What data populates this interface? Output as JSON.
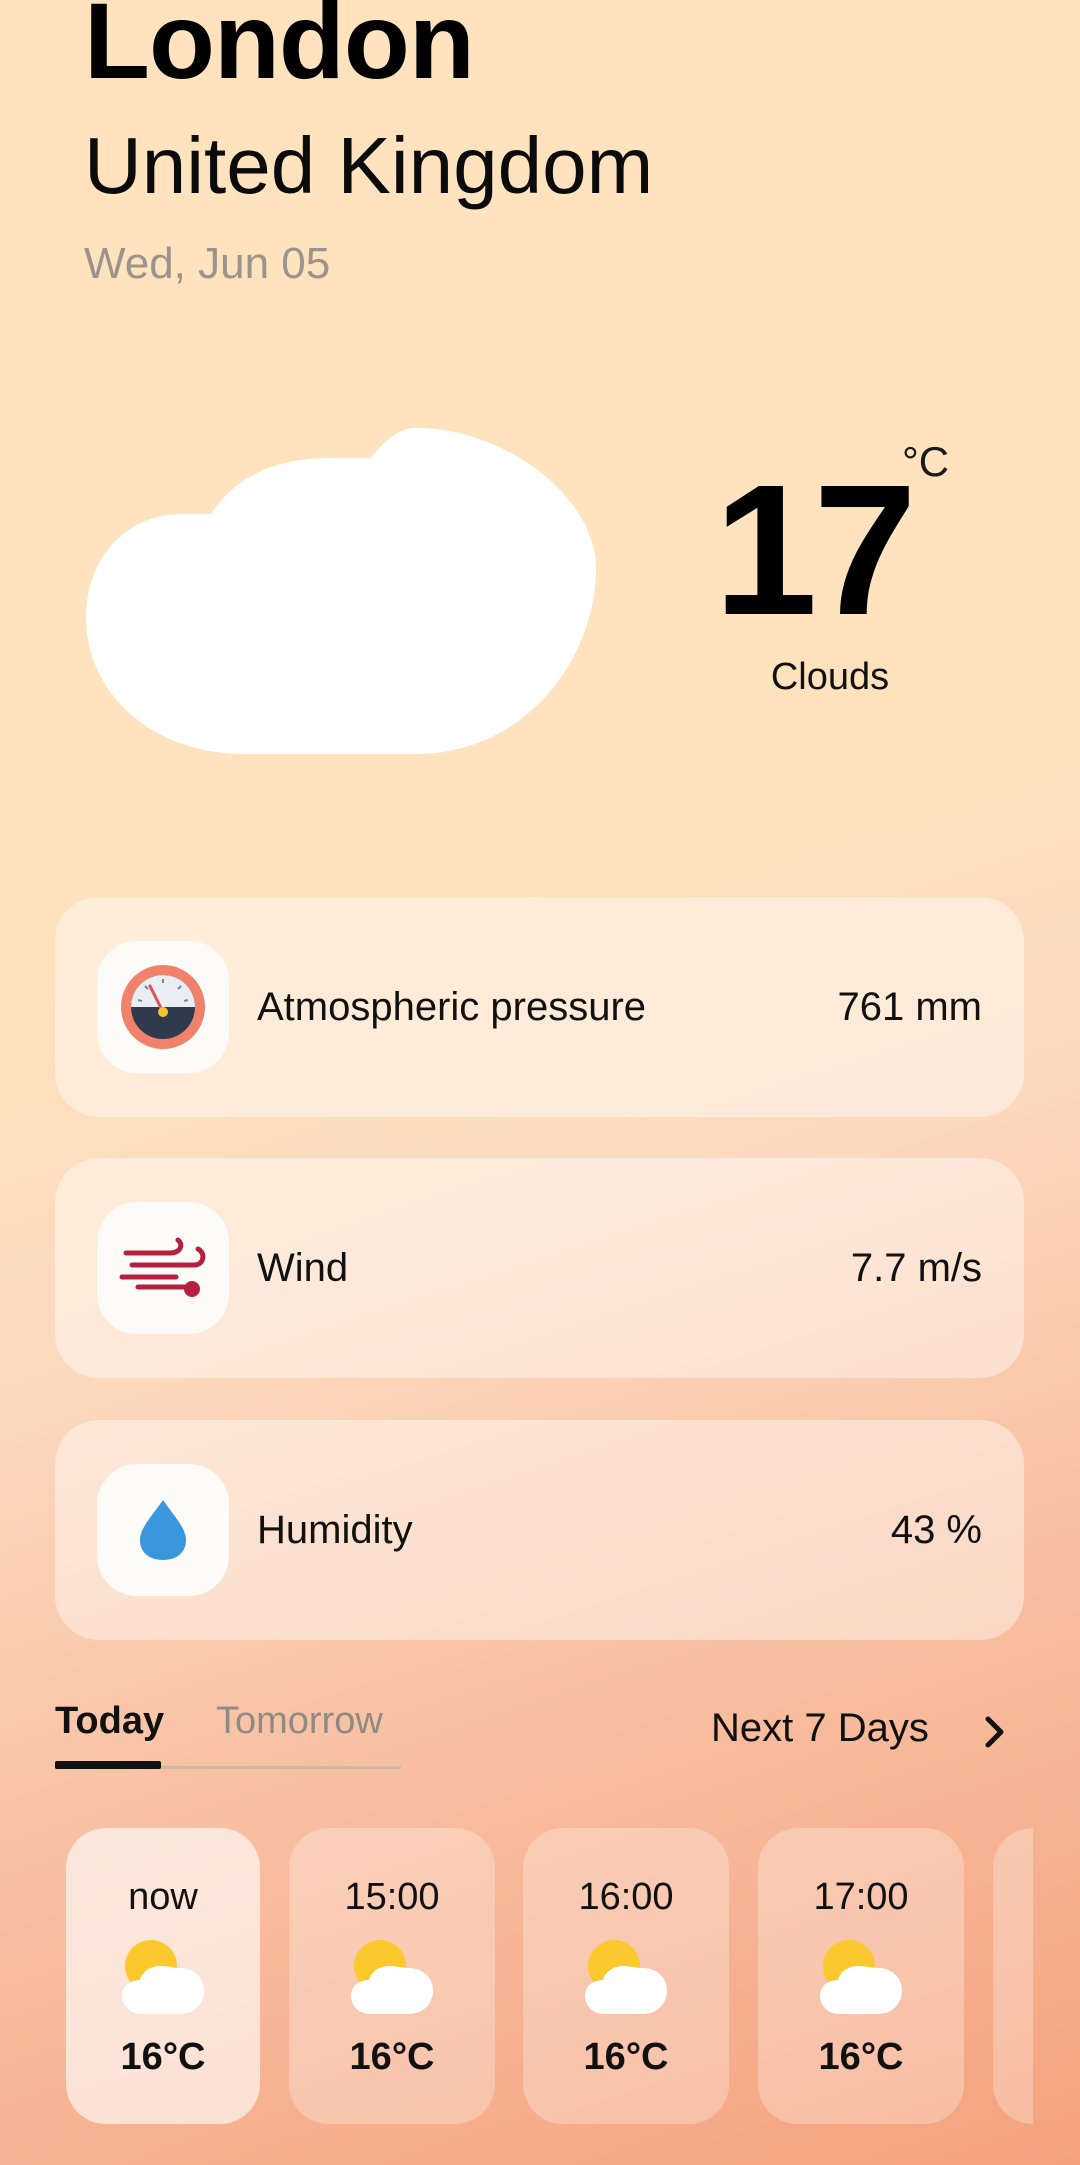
{
  "header": {
    "city": "London",
    "country": "United Kingdom",
    "date": "Wed, Jun 05"
  },
  "current": {
    "icon": "cloud-icon",
    "temperature": "17",
    "unit": "°C",
    "condition": "Clouds"
  },
  "details": [
    {
      "icon": "barometer-icon",
      "label": "Atmospheric pressure",
      "value": "761 mm"
    },
    {
      "icon": "wind-icon",
      "label": "Wind",
      "value": "7.7 m/s"
    },
    {
      "icon": "droplet-icon",
      "label": "Humidity",
      "value": "43 %"
    }
  ],
  "tabs": {
    "today": "Today",
    "tomorrow": "Tomorrow",
    "next7": "Next 7 Days"
  },
  "hourly": [
    {
      "time": "now",
      "icon": "partly-cloudy-icon",
      "temp": "16°C"
    },
    {
      "time": "15:00",
      "icon": "partly-cloudy-icon",
      "temp": "16°C"
    },
    {
      "time": "16:00",
      "icon": "partly-cloudy-icon",
      "temp": "16°C"
    },
    {
      "time": "17:00",
      "icon": "partly-cloudy-icon",
      "temp": "16°C"
    }
  ],
  "colors": {
    "background_top": "#fee3be",
    "background_bottom": "#f4a27e",
    "sun": "#fbc82d",
    "pressure_ring": "#f0816a",
    "wind": "#b3213f",
    "droplet": "#3b97dd"
  }
}
